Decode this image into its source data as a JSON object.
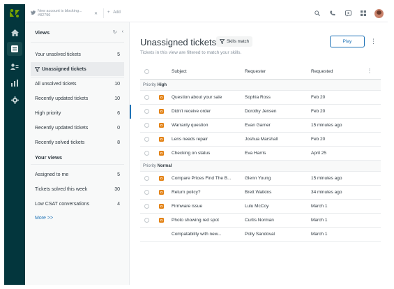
{
  "topbar": {
    "tab_title": "New account is blocking...",
    "tab_number": "#82796",
    "add_label": "Add"
  },
  "views": {
    "header": "Views",
    "items": [
      {
        "label": "Your unsolved tickets",
        "count": "5"
      },
      {
        "label": "Unassigned tickets",
        "count": ""
      },
      {
        "label": "All unsolved tickets",
        "count": "10"
      },
      {
        "label": "Recently updated tickets",
        "count": "10"
      },
      {
        "label": "High priority",
        "count": "6"
      },
      {
        "label": "Recently updated tickets",
        "count": "0"
      },
      {
        "label": "Recently solved tickets",
        "count": "8"
      }
    ],
    "your_views_header": "Your views",
    "your_items": [
      {
        "label": "Assigned to me",
        "count": "5"
      },
      {
        "label": "Tickets solved this week",
        "count": "30"
      },
      {
        "label": "Low CSAT conversations",
        "count": "4"
      }
    ],
    "more": "More >>"
  },
  "main": {
    "title": "Unassigned tickets",
    "skills_label": "Skills match",
    "subtitle": "Tickets in this view are filtered to match your skills.",
    "play_label": "Play",
    "columns": {
      "subject": "Subject",
      "requester": "Requester",
      "requested": "Requested"
    },
    "groups": {
      "high": {
        "prefix": "Priority",
        "name": "High"
      },
      "normal": {
        "prefix": "Priority",
        "name": "Normal"
      }
    },
    "status_letter": "O",
    "high_rows": [
      {
        "subject": "Question about your sale",
        "requester": "Sophia Ross",
        "requested": "Feb 20"
      },
      {
        "subject": "Didn't receive order",
        "requester": "Dorothy Jensen",
        "requested": "Feb 20"
      },
      {
        "subject": "Warranty question",
        "requester": "Evan Garner",
        "requested": "15 minutes ago"
      },
      {
        "subject": "Lens needs repair",
        "requester": "Joshua Marshall",
        "requested": "Feb 20"
      },
      {
        "subject": "Checking on status",
        "requester": "Eva Harris",
        "requested": "April 25"
      }
    ],
    "normal_rows": [
      {
        "subject": "Compare Prices Find The B...",
        "requester": "Glenn Young",
        "requested": "15 minutes ago"
      },
      {
        "subject": "Return policy?",
        "requester": "Brett Watkins",
        "requested": "34 minutes ago"
      },
      {
        "subject": "Firmware issue",
        "requester": "Lulu McCoy",
        "requested": "March 1"
      },
      {
        "subject": "Photo showing red spot",
        "requester": "Curtis Norman",
        "requested": "March 1"
      },
      {
        "subject": "Compatability with new...",
        "requester": "Polly Sandoval",
        "requested": "March 1"
      }
    ]
  },
  "colors": {
    "rail": "#03363d",
    "accent": "#1f73b7",
    "status_open": "#e38215"
  },
  "icons": {
    "rail": [
      "zendesk-logo",
      "home-icon",
      "views-icon",
      "customers-icon",
      "reporting-icon",
      "settings-icon"
    ],
    "topbar": [
      "search-icon",
      "phone-icon",
      "chat-icon",
      "apps-grid-icon",
      "avatar"
    ]
  }
}
